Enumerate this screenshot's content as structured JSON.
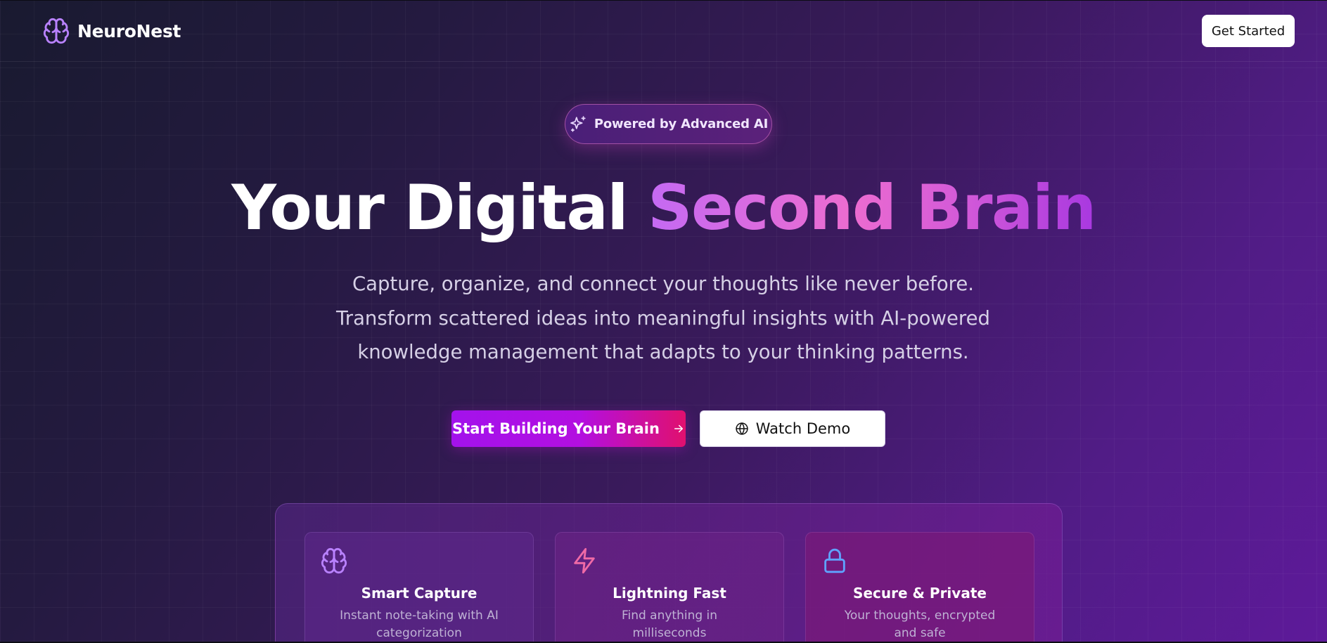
{
  "brand": {
    "name": "NeuroNest",
    "icon": "brain-icon",
    "accent": "#b982ff"
  },
  "nav": {
    "get_started_label": "Get Started"
  },
  "hero": {
    "badge": {
      "icon": "sparkles-icon",
      "text": "Powered by Advanced AI"
    },
    "title_plain": "Your Digital",
    "title_gradient": "Second Brain",
    "subtitle_lines": [
      "Capture, organize, and connect your thoughts like never before.",
      "Transform scattered ideas into meaningful insights with AI-powered",
      "knowledge management that adapts to your thinking patterns."
    ],
    "primary_cta": {
      "label": "Start Building Your Brain",
      "icon": "arrow-right-icon"
    },
    "secondary_cta": {
      "label": "Watch Demo",
      "icon": "globe-icon"
    }
  },
  "features": [
    {
      "icon": "brain-icon",
      "icon_color": "#b982ff",
      "title": "Smart Capture",
      "description": "Instant note-taking with AI categorization"
    },
    {
      "icon": "lightning-icon",
      "icon_color": "#f06aa6",
      "title": "Lightning Fast",
      "description": "Find anything in milliseconds"
    },
    {
      "icon": "lock-icon",
      "icon_color": "#5fa3ff",
      "title": "Secure & Private",
      "description": "Your thoughts, encrypted and safe"
    }
  ],
  "colors": {
    "gradient_text_start": "#c46af3",
    "gradient_text_mid": "#ec6cd0",
    "gradient_text_end": "#a838e0",
    "cta_start": "#a312ec",
    "cta_end": "#e0106e"
  }
}
